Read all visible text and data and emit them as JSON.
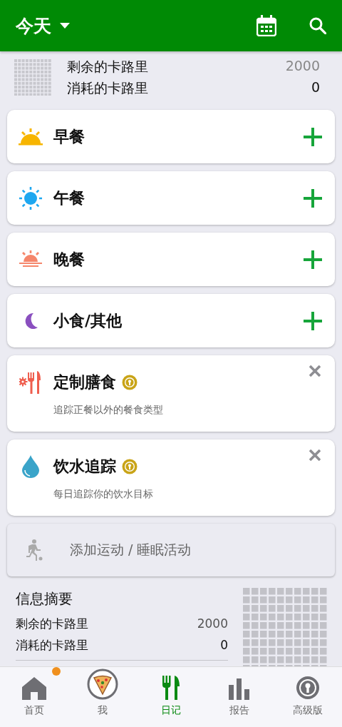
{
  "header": {
    "title": "今天"
  },
  "calorie_summary": {
    "rows": [
      {
        "label": "剩余的卡路里",
        "value": "2000"
      },
      {
        "label": "消耗的卡路里",
        "value": "0"
      }
    ]
  },
  "meals": [
    {
      "kind": "breakfast",
      "name": "早餐"
    },
    {
      "kind": "lunch",
      "name": "午餐"
    },
    {
      "kind": "dinner",
      "name": "晚餐"
    },
    {
      "kind": "snack",
      "name": "小食/其他"
    }
  ],
  "features": [
    {
      "kind": "custom",
      "name": "定制膳食",
      "description": "追踪正餐以外的餐食类型",
      "locked": true
    },
    {
      "kind": "water",
      "name": "饮水追踪",
      "description": "每日追踪你的饮水目标",
      "locked": true
    }
  ],
  "exercise_button": {
    "label": "添加运动 / 睡眠活动"
  },
  "info_summary": {
    "title": "信息摘要",
    "rows": [
      {
        "label": "剩余的卡路里",
        "value": "2000"
      },
      {
        "label": "消耗的卡路里",
        "value": "0"
      }
    ]
  },
  "nav": [
    {
      "kind": "home",
      "label": "首页",
      "selected": false,
      "badge": true
    },
    {
      "kind": "me",
      "label": "我",
      "selected": false,
      "badge": false
    },
    {
      "kind": "diary",
      "label": "日记",
      "selected": true,
      "badge": false
    },
    {
      "kind": "reports",
      "label": "报告",
      "selected": false,
      "badge": false
    },
    {
      "kind": "premium",
      "label": "高级版",
      "selected": false,
      "badge": false
    }
  ]
}
